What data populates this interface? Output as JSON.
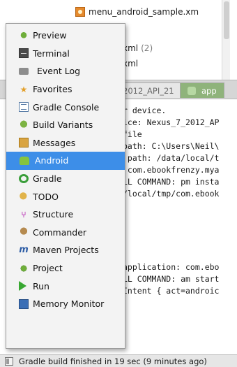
{
  "files": [
    {
      "name": "menu_android_sample.xm",
      "count": ""
    },
    {
      "name": "xml",
      "count": "(2)"
    },
    {
      "name": "xml",
      "count": ""
    }
  ],
  "tabs": [
    {
      "label": "2012_API_21"
    },
    {
      "label": "app"
    }
  ],
  "console_lines": [
    "r device.",
    "ice: Nexus_7_2012_AP",
    "file",
    "path: C:\\Users\\Neil\\",
    " path: /data/local/t",
    " com.ebookfrenzy.mya",
    "LL COMMAND: pm insta",
    "/local/tmp/com.ebook",
    "",
    "",
    "",
    "application: com.ebo",
    "LL COMMAND: am start",
    "Intent { act=androic"
  ],
  "menu": {
    "selected_index": 7,
    "items": [
      {
        "label": "Preview",
        "icon": "preview-icon"
      },
      {
        "label": "Terminal",
        "icon": "terminal-icon"
      },
      {
        "label": "Event Log",
        "icon": "event-log-icon"
      },
      {
        "label": "Favorites",
        "icon": "star-icon"
      },
      {
        "label": "Gradle Console",
        "icon": "gradle-console-icon"
      },
      {
        "label": "Build Variants",
        "icon": "build-variants-icon"
      },
      {
        "label": "Messages",
        "icon": "messages-icon"
      },
      {
        "label": "Android",
        "icon": "android-icon"
      },
      {
        "label": "Gradle",
        "icon": "gradle-icon"
      },
      {
        "label": "TODO",
        "icon": "todo-icon"
      },
      {
        "label": "Structure",
        "icon": "structure-icon"
      },
      {
        "label": "Commander",
        "icon": "commander-icon"
      },
      {
        "label": "Maven Projects",
        "icon": "maven-icon"
      },
      {
        "label": "Project",
        "icon": "project-icon"
      },
      {
        "label": "Run",
        "icon": "run-icon"
      },
      {
        "label": "Memory Monitor",
        "icon": "memory-monitor-icon"
      }
    ]
  },
  "status": {
    "text": "Gradle build finished in 19 sec (9 minutes ago)"
  },
  "colors": {
    "selection": "#3d8ee8",
    "app_tab": "#8fb37b"
  }
}
